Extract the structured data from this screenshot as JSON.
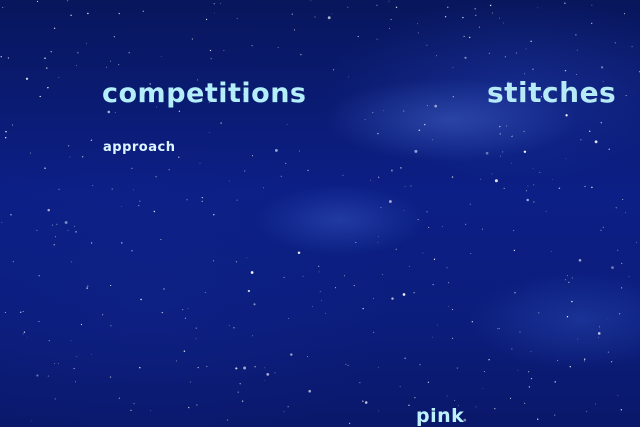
{
  "labels": {
    "competitions": "competitions",
    "stitches": "stitches",
    "approach": "approach",
    "pink": "pink"
  }
}
